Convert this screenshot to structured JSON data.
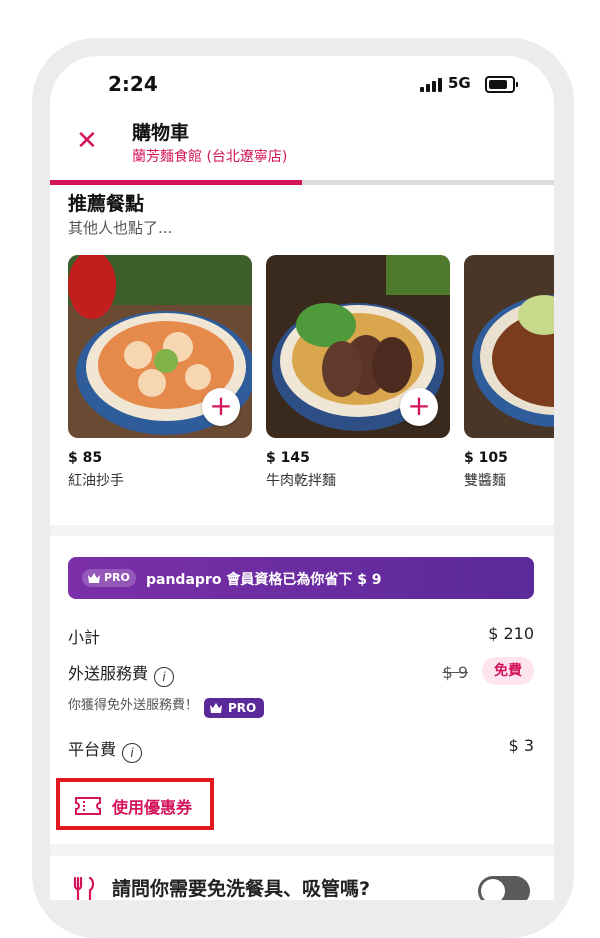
{
  "status_bar": {
    "time": "2:24",
    "network": "5G"
  },
  "header": {
    "title": "購物車",
    "restaurant": "蘭芳麵食館 (台北遼寧店)",
    "progress": 0.5
  },
  "recommendations": {
    "title": "推薦餐點",
    "subtitle": "其他人也點了...",
    "items": [
      {
        "price": "$ 85",
        "name": "紅油抄手",
        "add_icon": "plus-icon"
      },
      {
        "price": "$ 145",
        "name": "牛肉乾拌麵",
        "add_icon": "plus-icon"
      },
      {
        "price": "$ 105",
        "name": "雙醬麵",
        "add_icon": "plus-icon"
      }
    ]
  },
  "pro_banner": {
    "badge": "PRO",
    "text": "pandapro 會員資格已為你省下 $ 9"
  },
  "summary": {
    "subtotal_label": "小計",
    "subtotal_value": "$ 210",
    "delivery_label": "外送服務費",
    "delivery_original": "$ 9",
    "delivery_free": "免費",
    "delivery_note": "你獲得免外送服務費！",
    "delivery_note_badge": "PRO",
    "platform_label": "平台費",
    "platform_value": "$ 3"
  },
  "coupon": {
    "label": "使用優惠券",
    "icon": "coupon-icon"
  },
  "cutlery": {
    "question": "請問你需要免洗餐具、吸管嗎?",
    "toggle_on": false
  },
  "colors": {
    "brand": "#d4145a",
    "pro_purple": "#5b2a9a",
    "highlight_box": "#e0191e"
  }
}
